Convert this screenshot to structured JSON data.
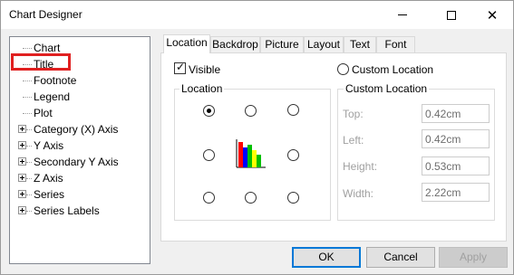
{
  "window": {
    "title": "Chart Designer"
  },
  "tree": {
    "items": [
      {
        "label": "Chart",
        "expandable": false
      },
      {
        "label": "Title",
        "expandable": false
      },
      {
        "label": "Footnote",
        "expandable": false
      },
      {
        "label": "Legend",
        "expandable": false
      },
      {
        "label": "Plot",
        "expandable": false
      },
      {
        "label": "Category (X) Axis",
        "expandable": true
      },
      {
        "label": "Y Axis",
        "expandable": true
      },
      {
        "label": "Secondary Y Axis",
        "expandable": true
      },
      {
        "label": "Z Axis",
        "expandable": true
      },
      {
        "label": "Series",
        "expandable": true
      },
      {
        "label": "Series Labels",
        "expandable": true
      }
    ]
  },
  "tabs": [
    {
      "label": "Location",
      "active": true
    },
    {
      "label": "Backdrop",
      "active": false
    },
    {
      "label": "Picture",
      "active": false
    },
    {
      "label": "Layout",
      "active": false
    },
    {
      "label": "Text",
      "active": false
    },
    {
      "label": "Font",
      "active": false
    }
  ],
  "location_tab": {
    "visible_label": "Visible",
    "visible_checked": true,
    "custom_location_label": "Custom Location",
    "location_group_title": "Location",
    "selected_position": "top-left",
    "custom_group_title": "Custom Location",
    "fields": [
      {
        "label": "Top:",
        "value": "0.42cm"
      },
      {
        "label": "Left:",
        "value": "0.42cm"
      },
      {
        "label": "Height:",
        "value": "0.53cm"
      },
      {
        "label": "Width:",
        "value": "2.22cm"
      }
    ]
  },
  "buttons": {
    "ok": "OK",
    "cancel": "Cancel",
    "apply": "Apply"
  },
  "colors": {
    "highlight": "#e02020",
    "bar_red": "#ff0000",
    "bar_blue": "#0000ff",
    "bar_green": "#00c000",
    "bar_yellow": "#ffff00"
  }
}
